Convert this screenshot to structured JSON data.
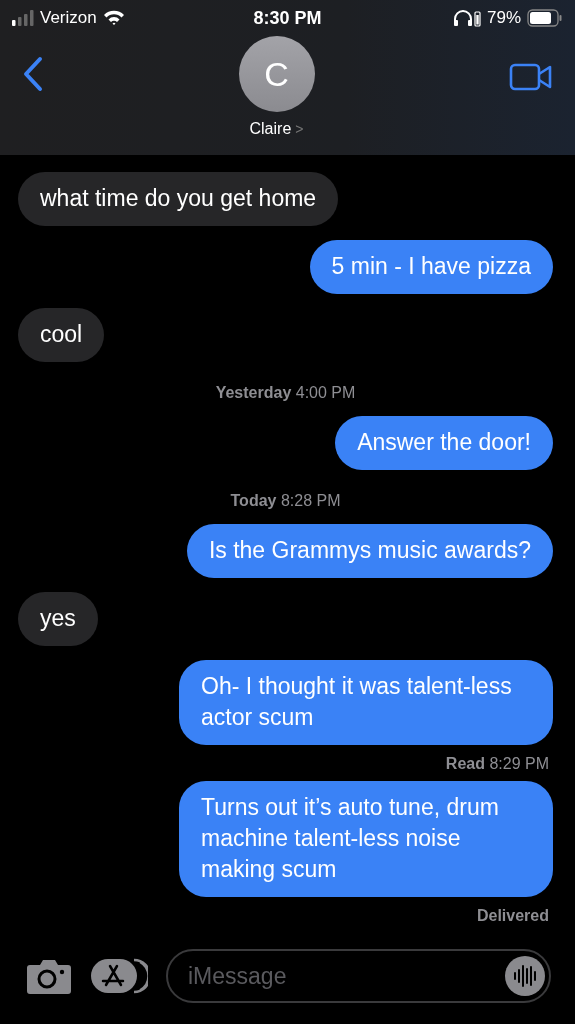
{
  "status_bar": {
    "carrier": "Verizon",
    "time": "8:30 PM",
    "battery": "79%"
  },
  "contact": {
    "initial": "C",
    "name": "Claire",
    "chevron": ">"
  },
  "messages": [
    {
      "kind": "received",
      "text": "what time do you get home"
    },
    {
      "kind": "sent",
      "text": "5 min - I have pizza"
    },
    {
      "kind": "received",
      "text": "cool"
    },
    {
      "kind": "timestamp",
      "text": "**Yesterday** 4:00 PM"
    },
    {
      "kind": "sent",
      "text": "Answer the door!"
    },
    {
      "kind": "timestamp",
      "text": "**Today** 8:28 PM"
    },
    {
      "kind": "sent",
      "text": "Is the Grammys music awards?"
    },
    {
      "kind": "received",
      "text": "yes"
    },
    {
      "kind": "sent",
      "text": "Oh- I thought it was talent-less actor scum"
    },
    {
      "kind": "status",
      "text": "**Read** 8:29 PM"
    },
    {
      "kind": "sent",
      "text": "Turns out it’s auto tune, drum machine talent-less noise making scum"
    },
    {
      "kind": "status",
      "text": "**Delivered**"
    }
  ],
  "composer": {
    "placeholder": "iMessage"
  }
}
